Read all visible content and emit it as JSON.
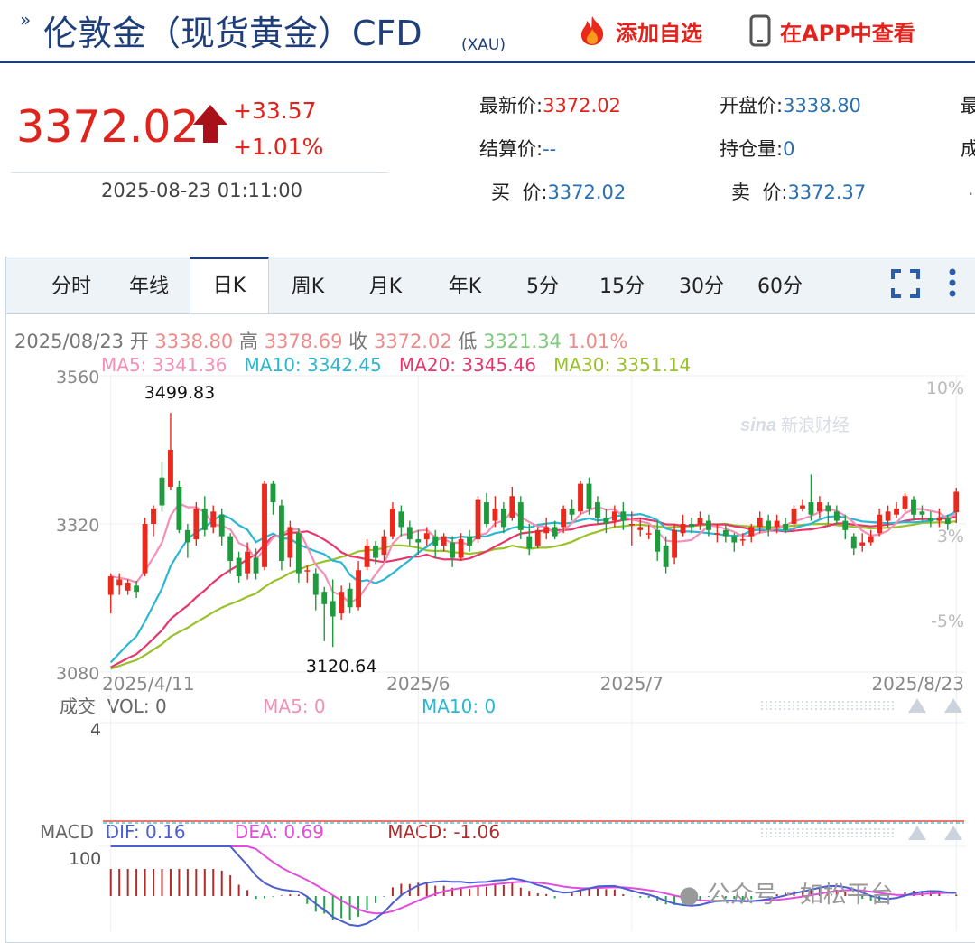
{
  "header": {
    "title": "伦敦金（现货黄金）CFD",
    "title_sub": "(XAU)",
    "favorite_label": "添加自选",
    "app_label": "在APP中查看"
  },
  "quote": {
    "price": "3372.02",
    "change": "+33.57",
    "change_pct": "+1.01%",
    "timestamp": "2025-08-23 01:11:00",
    "fields": [
      {
        "label": "最新价:",
        "value": "3372.02"
      },
      {
        "label": "开盘价:",
        "value": "3338.80"
      },
      {
        "label": "结算价:",
        "value": "--"
      },
      {
        "label": "持仓量:",
        "value": "0"
      },
      {
        "label": "买  价:",
        "value": "3372.02"
      },
      {
        "label": "卖  价:",
        "value": "3372.37"
      }
    ],
    "truncated": [
      "最",
      "成",
      "."
    ]
  },
  "tabs": [
    "分时",
    "年线",
    "日K",
    "周K",
    "月K",
    "年K",
    "5分",
    "15分",
    "30分",
    "60分"
  ],
  "active_tab": "日K",
  "ohlc": {
    "date": "2025/08/23",
    "open_label": "开",
    "open": "3338.80",
    "high_label": "高",
    "high": "3378.69",
    "close_label": "收",
    "close": "3372.02",
    "low_label": "低",
    "low": "3321.34",
    "pct": "1.01%"
  },
  "ma": {
    "ma5": "MA5: 3341.36",
    "ma10": "MA10: 3342.45",
    "ma20": "MA20: 3345.46",
    "ma30": "MA30: 3351.14"
  },
  "volume": {
    "title": "成交",
    "vol": "VOL: 0",
    "ma5": "MA5: 0",
    "ma10": "MA10: 0",
    "ymax": "4"
  },
  "macd": {
    "title": "MACD",
    "dif": "DIF: 0.16",
    "dea": "DEA: 0.69",
    "macd": "MACD: -1.06",
    "ymax": "100"
  },
  "chart_logo": "新浪财经",
  "watermark": "公众号 · 如松平台",
  "colors": {
    "up": "#e8291c",
    "down": "#1e9b3c",
    "ma5": "#f58fb6",
    "ma10": "#2bb7d1",
    "ma20": "#e7366b",
    "ma30": "#99c12a",
    "dif": "#4b5fd1",
    "dea": "#e24ddb",
    "brand": "#1f3f7a",
    "accent": "#e0231c"
  },
  "chart_data": {
    "type": "candlestick",
    "ylim": [
      3080,
      3560
    ],
    "yticks": [
      3560,
      3320,
      3080
    ],
    "pct_ticks": [
      "10%",
      "3%",
      "-5%"
    ],
    "xticks": [
      "2025/4/11",
      "2025/6",
      "2025/7",
      "2025/8/23"
    ],
    "xtick_index": [
      0,
      36,
      61,
      99
    ],
    "annotations": [
      {
        "text": "3499.83",
        "index": 7,
        "value": 3499.83
      },
      {
        "text": "3120.64",
        "index": 27,
        "value": 3120.64
      }
    ],
    "candles": [
      [
        3205,
        3235,
        3175,
        3240
      ],
      [
        3220,
        3230,
        3205,
        3240
      ],
      [
        3212,
        3225,
        3205,
        3230
      ],
      [
        3220,
        3210,
        3200,
        3228
      ],
      [
        3240,
        3320,
        3235,
        3330
      ],
      [
        3320,
        3345,
        3300,
        3350
      ],
      [
        3395,
        3350,
        3340,
        3420
      ],
      [
        3380,
        3440,
        3375,
        3499.83
      ],
      [
        3380,
        3310,
        3305,
        3390
      ],
      [
        3310,
        3290,
        3265,
        3320
      ],
      [
        3295,
        3345,
        3285,
        3355
      ],
      [
        3345,
        3310,
        3300,
        3365
      ],
      [
        3315,
        3340,
        3305,
        3350
      ],
      [
        3335,
        3300,
        3285,
        3345
      ],
      [
        3300,
        3260,
        3240,
        3305
      ],
      [
        3265,
        3235,
        3225,
        3275
      ],
      [
        3240,
        3275,
        3230,
        3290
      ],
      [
        3265,
        3240,
        3230,
        3280
      ],
      [
        3250,
        3385,
        3245,
        3390
      ],
      [
        3385,
        3355,
        3335,
        3390
      ],
      [
        3350,
        3260,
        3245,
        3360
      ],
      [
        3265,
        3315,
        3250,
        3325
      ],
      [
        3305,
        3240,
        3225,
        3312
      ],
      [
        3245,
        3245,
        3225,
        3252
      ],
      [
        3240,
        3205,
        3180,
        3248
      ],
      [
        3210,
        3190,
        3130,
        3218
      ],
      [
        3195,
        3170,
        3120.64,
        3230
      ],
      [
        3175,
        3210,
        3165,
        3220
      ],
      [
        3215,
        3185,
        3175,
        3225
      ],
      [
        3185,
        3245,
        3180,
        3260
      ],
      [
        3250,
        3285,
        3245,
        3295
      ],
      [
        3285,
        3265,
        3255,
        3292
      ],
      [
        3270,
        3300,
        3260,
        3310
      ],
      [
        3300,
        3345,
        3295,
        3355
      ],
      [
        3340,
        3315,
        3300,
        3350
      ],
      [
        3315,
        3295,
        3285,
        3325
      ],
      [
        3295,
        3290,
        3270,
        3310
      ],
      [
        3295,
        3305,
        3285,
        3315
      ],
      [
        3300,
        3285,
        3265,
        3310
      ],
      [
        3285,
        3300,
        3275,
        3305
      ],
      [
        3290,
        3265,
        3250,
        3300
      ],
      [
        3265,
        3295,
        3260,
        3305
      ],
      [
        3300,
        3285,
        3275,
        3310
      ],
      [
        3295,
        3360,
        3290,
        3365
      ],
      [
        3355,
        3320,
        3315,
        3370
      ],
      [
        3325,
        3345,
        3315,
        3365
      ],
      [
        3345,
        3315,
        3305,
        3355
      ],
      [
        3330,
        3365,
        3325,
        3380
      ],
      [
        3355,
        3310,
        3295,
        3365
      ],
      [
        3300,
        3280,
        3270,
        3320
      ],
      [
        3285,
        3310,
        3280,
        3315
      ],
      [
        3305,
        3315,
        3295,
        3330
      ],
      [
        3315,
        3300,
        3295,
        3325
      ],
      [
        3315,
        3345,
        3305,
        3350
      ],
      [
        3345,
        3335,
        3325,
        3360
      ],
      [
        3340,
        3385,
        3335,
        3390
      ],
      [
        3385,
        3345,
        3335,
        3395
      ],
      [
        3355,
        3330,
        3320,
        3365
      ],
      [
        3330,
        3320,
        3305,
        3345
      ],
      [
        3325,
        3340,
        3315,
        3350
      ],
      [
        3340,
        3325,
        3310,
        3355
      ],
      [
        3320,
        3320,
        3285,
        3340
      ],
      [
        3310,
        3315,
        3300,
        3330
      ],
      [
        3305,
        3305,
        3295,
        3318
      ],
      [
        3310,
        3275,
        3260,
        3325
      ],
      [
        3285,
        3250,
        3240,
        3300
      ],
      [
        3265,
        3310,
        3255,
        3320
      ],
      [
        3305,
        3320,
        3300,
        3335
      ],
      [
        3320,
        3315,
        3305,
        3330
      ],
      [
        3320,
        3330,
        3310,
        3340
      ],
      [
        3325,
        3310,
        3300,
        3335
      ],
      [
        3305,
        3305,
        3290,
        3320
      ],
      [
        3310,
        3300,
        3290,
        3318
      ],
      [
        3300,
        3290,
        3275,
        3305
      ],
      [
        3295,
        3295,
        3285,
        3305
      ],
      [
        3300,
        3315,
        3290,
        3320
      ],
      [
        3315,
        3330,
        3305,
        3340
      ],
      [
        3325,
        3310,
        3300,
        3335
      ],
      [
        3315,
        3325,
        3305,
        3335
      ],
      [
        3320,
        3310,
        3305,
        3330
      ],
      [
        3320,
        3345,
        3310,
        3350
      ],
      [
        3345,
        3350,
        3340,
        3360
      ],
      [
        3355,
        3335,
        3325,
        3400
      ],
      [
        3340,
        3355,
        3330,
        3365
      ],
      [
        3350,
        3340,
        3320,
        3355
      ],
      [
        3340,
        3325,
        3320,
        3350
      ],
      [
        3325,
        3310,
        3295,
        3335
      ],
      [
        3300,
        3280,
        3270,
        3305
      ],
      [
        3285,
        3290,
        3275,
        3305
      ],
      [
        3290,
        3300,
        3285,
        3310
      ],
      [
        3305,
        3335,
        3300,
        3345
      ],
      [
        3325,
        3340,
        3315,
        3350
      ],
      [
        3335,
        3345,
        3330,
        3355
      ],
      [
        3345,
        3365,
        3340,
        3370
      ],
      [
        3360,
        3335,
        3325,
        3365
      ],
      [
        3340,
        3335,
        3325,
        3350
      ],
      [
        3330,
        3325,
        3315,
        3340
      ],
      [
        3325,
        3330,
        3315,
        3345
      ],
      [
        3330,
        3320,
        3310,
        3335
      ],
      [
        3338.8,
        3372.02,
        3321.34,
        3378.69
      ]
    ]
  }
}
